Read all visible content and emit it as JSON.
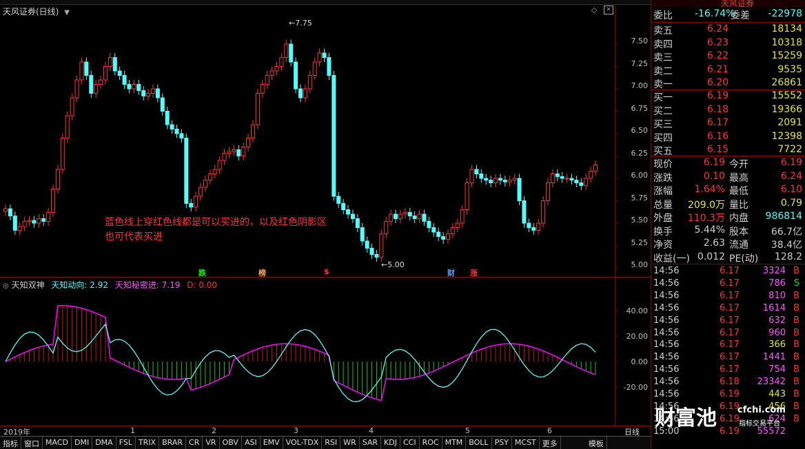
{
  "colors": {
    "up": "#ff3232",
    "down": "#54fcfc",
    "ma_magenta": "#ff00ff",
    "cyan_line": "#54fcfc",
    "grid": "#8b0000",
    "yellow": "#e6e63c",
    "text": "#c0c0c0"
  },
  "main_chart": {
    "title": "天风证券(日线)",
    "price_axis": [
      "7.50",
      "7.25",
      "7.00",
      "6.75",
      "6.50",
      "6.25",
      "6.00",
      "5.75",
      "5.50",
      "5.25",
      "5.00"
    ],
    "high_label": "7.75",
    "low_label": "5.00",
    "annotation_line1": "蓝色线上穿红色线都是可以买进的，以及红色阴影区",
    "annotation_line2": "也可代表买进",
    "signals": [
      {
        "text": "跌",
        "color": "#00ff00"
      },
      {
        "text": "榜",
        "color": "#ffb050"
      },
      {
        "text": "$",
        "color": "#ff3232"
      },
      {
        "text": "财",
        "color": "#54a0ff"
      },
      {
        "text": "涨",
        "color": "#ff3232"
      }
    ]
  },
  "indicator": {
    "name": "天知双神",
    "line1_label": "天知动向: 2.92",
    "line2_label": "天知秘密进: 7.19",
    "line3_label": "D: 0.00",
    "axis": [
      "40.00",
      "20.00",
      "0.00",
      "-20.00"
    ]
  },
  "x_axis": {
    "labels": [
      "2019年",
      "1",
      "2",
      "3",
      "4",
      "5",
      "6"
    ],
    "period": "日线"
  },
  "bottom_tabs": [
    "指标",
    "窗口",
    "MACD",
    "DMI",
    "DMA",
    "FSL",
    "TRIX",
    "BRAR",
    "CR",
    "VR",
    "OBV",
    "ASI",
    "EMV",
    "VOL-TDX",
    "RSI",
    "WR",
    "SAR",
    "KDJ",
    "CCI",
    "ROC",
    "MTM",
    "BOLL",
    "PSY",
    "MCST",
    "更多",
    "模板"
  ],
  "quote": {
    "header": "天风证券",
    "wb_label": "委比",
    "wb_value": "-16.74%",
    "wc_label": "委差",
    "wc_value": "-22978",
    "asks": [
      {
        "label": "卖五",
        "price": "6.24",
        "vol": "18134"
      },
      {
        "label": "卖四",
        "price": "6.23",
        "vol": "10318"
      },
      {
        "label": "卖三",
        "price": "6.22",
        "vol": "15259"
      },
      {
        "label": "卖二",
        "price": "6.21",
        "vol": "9535"
      },
      {
        "label": "卖一",
        "price": "6.20",
        "vol": "26861"
      }
    ],
    "bids": [
      {
        "label": "买一",
        "price": "6.19",
        "vol": "15552"
      },
      {
        "label": "买二",
        "price": "6.18",
        "vol": "19366"
      },
      {
        "label": "买三",
        "price": "6.17",
        "vol": "2091"
      },
      {
        "label": "买四",
        "price": "6.16",
        "vol": "12398"
      },
      {
        "label": "买五",
        "price": "6.15",
        "vol": "7722"
      }
    ],
    "stats": [
      {
        "l1": "现价",
        "v1": "6.19",
        "l2": "今开",
        "v2": "6.19",
        "c1": "#ff3232",
        "c2": "#ff3232"
      },
      {
        "l1": "涨跌",
        "v1": "0.10",
        "l2": "最高",
        "v2": "6.24",
        "c1": "#ff3232",
        "c2": "#ff3232"
      },
      {
        "l1": "涨幅",
        "v1": "1.64%",
        "l2": "最低",
        "v2": "6.10",
        "c1": "#ff3232",
        "c2": "#ff3232"
      },
      {
        "l1": "总量",
        "v1": "209.0万",
        "l2": "量比",
        "v2": "0.79",
        "c1": "#e6e63c",
        "c2": "#e6e63c"
      },
      {
        "l1": "外盘",
        "v1": "110.3万",
        "l2": "内盘",
        "v2": "986814",
        "c1": "#ff3232",
        "c2": "#54fcfc"
      },
      {
        "l1": "换手",
        "v1": "5.44%",
        "l2": "股本",
        "v2": "66.7亿",
        "c1": "#d0d0d0",
        "c2": "#d0d0d0"
      },
      {
        "l1": "净资",
        "v1": "2.63",
        "l2": "流通",
        "v2": "38.4亿",
        "c1": "#d0d0d0",
        "c2": "#d0d0d0"
      },
      {
        "l1": "收益(一)",
        "v1": "0.012",
        "l2": "PE(动)",
        "v2": "128.2",
        "c1": "#d0d0d0",
        "c2": "#d0d0d0"
      }
    ],
    "ticks": [
      {
        "time": "14:56",
        "price": "6.17",
        "vol": "3324",
        "bs": "B",
        "vc": "#ff55ff"
      },
      {
        "time": "14:56",
        "price": "6.17",
        "vol": "786",
        "bs": "S",
        "vc": "#ff55ff"
      },
      {
        "time": "14:56",
        "price": "6.17",
        "vol": "810",
        "bs": "B",
        "vc": "#ff55ff"
      },
      {
        "time": "14:56",
        "price": "6.17",
        "vol": "1614",
        "bs": "B",
        "vc": "#ff55ff"
      },
      {
        "time": "14:56",
        "price": "6.17",
        "vol": "632",
        "bs": "B",
        "vc": "#ff55ff"
      },
      {
        "time": "14:56",
        "price": "6.17",
        "vol": "960",
        "bs": "B",
        "vc": "#ff55ff"
      },
      {
        "time": "14:56",
        "price": "6.17",
        "vol": "366",
        "bs": "B",
        "vc": "#e6e63c"
      },
      {
        "time": "14:56",
        "price": "6.17",
        "vol": "1441",
        "bs": "B",
        "vc": "#ff55ff"
      },
      {
        "time": "14:56",
        "price": "6.17",
        "vol": "754",
        "bs": "B",
        "vc": "#ff55ff"
      },
      {
        "time": "14:56",
        "price": "6.18",
        "vol": "23342",
        "bs": "B",
        "vc": "#ff55ff"
      },
      {
        "time": "14:56",
        "price": "6.19",
        "vol": "443",
        "bs": "B",
        "vc": "#e6e63c"
      },
      {
        "time": "14:56",
        "price": "6.19",
        "vol": "456",
        "bs": "B",
        "vc": "#e6e63c"
      },
      {
        "time": "14:56",
        "price": "6.19",
        "vol": "624",
        "bs": "B",
        "vc": "#ff55ff"
      },
      {
        "time": "15:00",
        "price": "6.19",
        "vol": "55572",
        "bs": "",
        "vc": "#ff55ff"
      }
    ]
  },
  "watermark": {
    "big": "财富池",
    "site": "cfchi.com",
    "sub": "指标交易平台"
  }
}
